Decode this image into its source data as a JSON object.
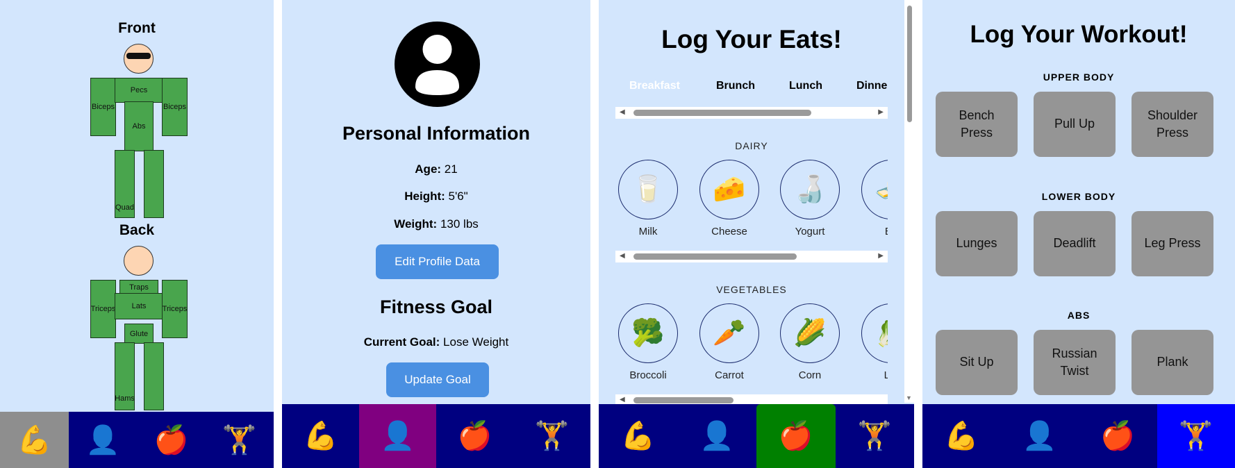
{
  "nav": {
    "strength_emoji": "💪",
    "profile_emoji": "👤",
    "food_emoji": "🍎",
    "workout_emoji": "🏋️"
  },
  "body_map": {
    "front_title": "Front",
    "back_title": "Back",
    "front": {
      "pecs": "Pecs",
      "biceps_left": "Biceps",
      "biceps_right": "Biceps",
      "abs": "Abs",
      "quad": "Quad"
    },
    "back": {
      "traps": "Traps",
      "triceps_left": "Triceps",
      "lats": "Lats",
      "triceps_right": "Triceps",
      "glute": "Glute",
      "hams": "Hams"
    },
    "muscle_color": "#49a54d",
    "skin_color": "#fdd5b3"
  },
  "profile": {
    "personal_title": "Personal Information",
    "age_label": "Age:",
    "age_value": "21",
    "height_label": "Height:",
    "height_value": "5'6\"",
    "weight_label": "Weight:",
    "weight_value": "130 lbs",
    "edit_button": "Edit Profile Data",
    "fitness_title": "Fitness Goal",
    "goal_label": "Current Goal:",
    "goal_value": "Lose Weight",
    "update_button": "Update Goal",
    "button_color": "#4a90e2"
  },
  "eats": {
    "title": "Log Your Eats!",
    "meal_tabs": [
      "Breakfast",
      "Brunch",
      "Lunch",
      "Dinne"
    ],
    "selected_tab": "Breakfast",
    "dairy_label": "DAIRY",
    "dairy_items": [
      {
        "name": "Milk",
        "emoji": "🥛"
      },
      {
        "name": "Cheese",
        "emoji": "🧀"
      },
      {
        "name": "Yogurt",
        "emoji": "🍶"
      },
      {
        "name": "Bu",
        "emoji": "🧈"
      }
    ],
    "vegetables_label": "VEGETABLES",
    "vegetable_items": [
      {
        "name": "Broccoli",
        "emoji": "🥦"
      },
      {
        "name": "Carrot",
        "emoji": "🥕"
      },
      {
        "name": "Corn",
        "emoji": "🌽"
      },
      {
        "name": "Let",
        "emoji": "🥬"
      }
    ]
  },
  "workout": {
    "title": "Log Your Workout!",
    "upper_label": "UPPER BODY",
    "upper": [
      "Bench Press",
      "Pull Up",
      "Shoulder Press"
    ],
    "lower_label": "LOWER BODY",
    "lower": [
      "Lunges",
      "Deadlift",
      "Leg Press"
    ],
    "abs_label": "ABS",
    "abs": [
      "Sit Up",
      "Russian Twist",
      "Plank"
    ]
  },
  "colors": {
    "background": "#d3e6fd",
    "nav_bar": "#000080",
    "active_strength": "#8e8e8e",
    "active_profile": "#800080",
    "active_food": "#008000",
    "active_workout": "#0000ff",
    "exercise_button": "#959595"
  }
}
